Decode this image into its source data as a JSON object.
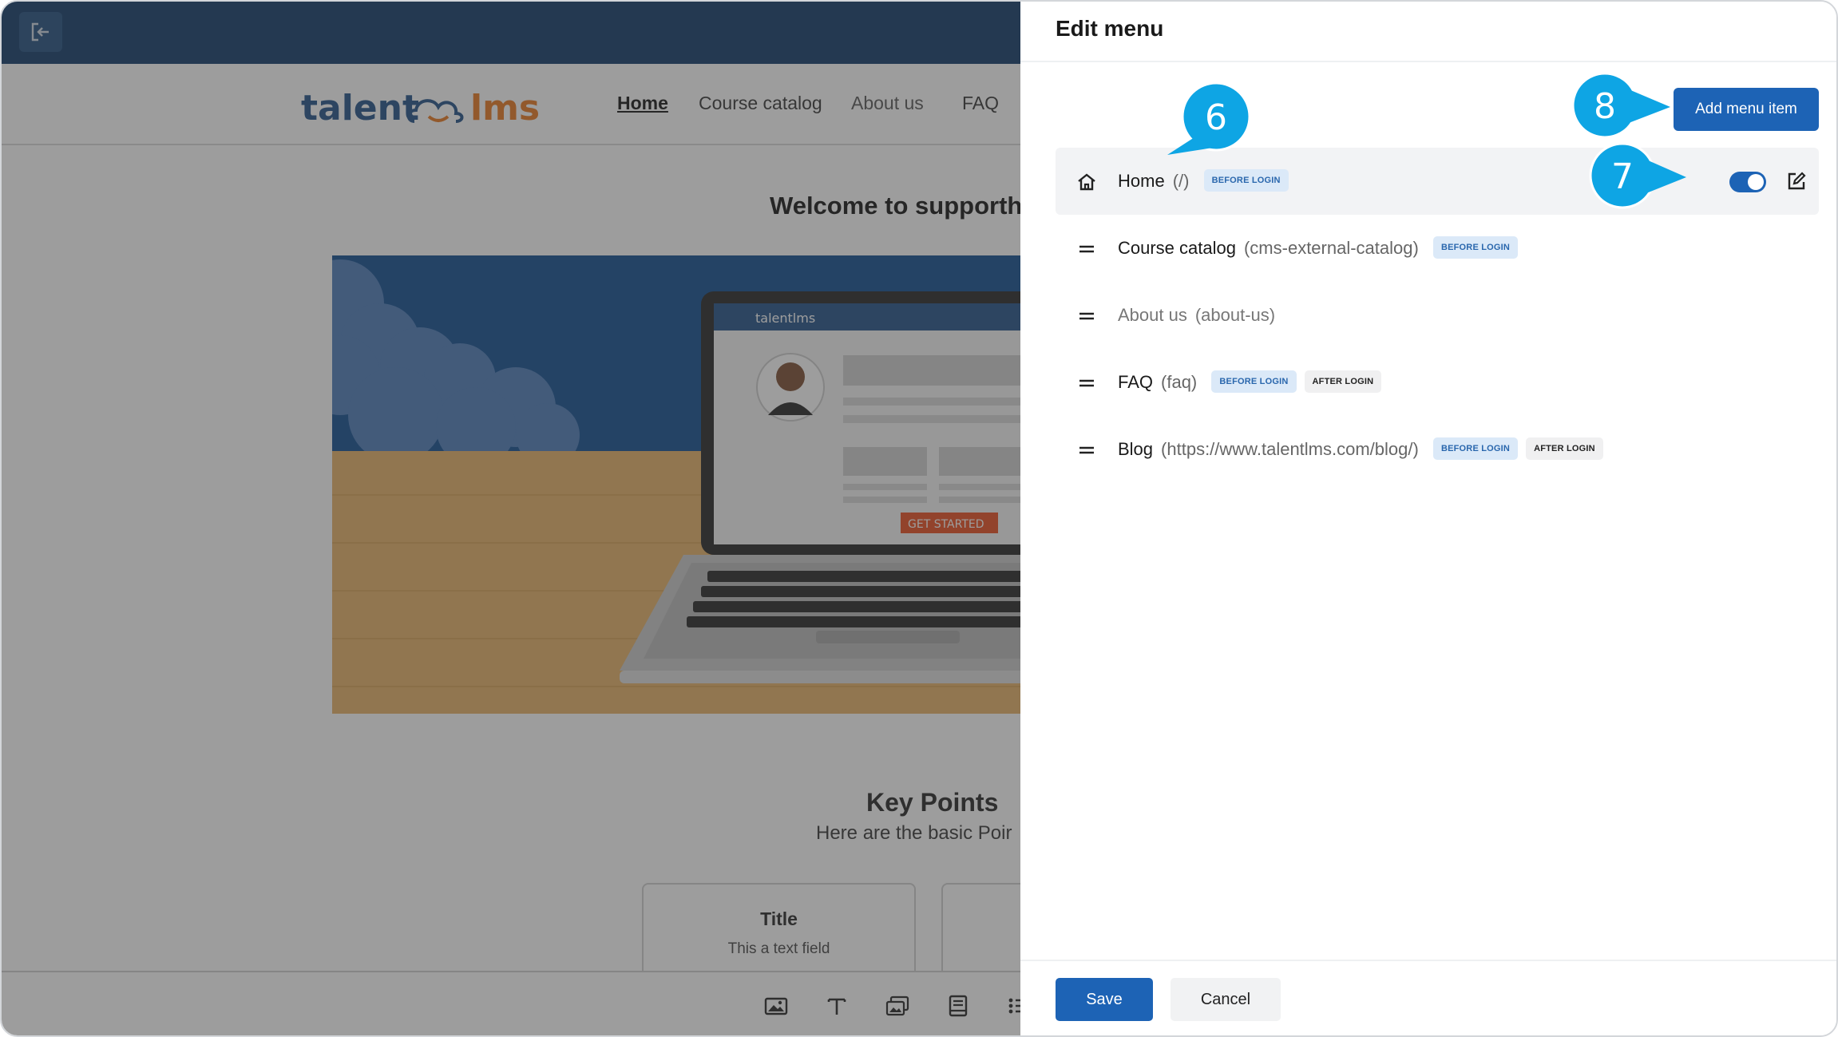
{
  "site": {
    "logo_left": "talent",
    "logo_right": "lms",
    "nav": [
      "Home",
      "Course catalog",
      "About us",
      "FAQ"
    ],
    "welcome_title": "Welcome to supporth",
    "hero": {
      "laptop_logo": "talentlms",
      "cta": "GET STARTED"
    },
    "key_points_title": "Key Points",
    "key_points_sub": "Here are the basic Poir",
    "card": {
      "title": "Title",
      "text": "This a text field"
    }
  },
  "panel": {
    "title": "Edit menu",
    "add_button": "Add menu item",
    "items": [
      {
        "label": "Home",
        "path": "(/)",
        "tags": [
          "BEFORE LOGIN"
        ],
        "icon": "home-icon"
      },
      {
        "label": "Course catalog",
        "path": "(cms-external-catalog)",
        "tags": [
          "BEFORE LOGIN"
        ],
        "icon": "drag-handle-icon"
      },
      {
        "label": "About us",
        "path": "(about-us)",
        "tags": [],
        "icon": "drag-handle-icon"
      },
      {
        "label": "FAQ",
        "path": "(faq)",
        "tags": [
          "BEFORE LOGIN",
          "AFTER LOGIN"
        ],
        "icon": "drag-handle-icon"
      },
      {
        "label": "Blog",
        "path": "(https://www.talentlms.com/blog/)",
        "tags": [
          "BEFORE LOGIN",
          "AFTER LOGIN"
        ],
        "icon": "drag-handle-icon"
      }
    ],
    "save_button": "Save",
    "cancel_button": "Cancel"
  },
  "callouts": [
    "6",
    "7",
    "8"
  ],
  "colors": {
    "topbar": "#0d3766",
    "primary": "#1d63b5",
    "callout": "#0ea5e4",
    "tag_before_bg": "#dbe9f8",
    "tag_after_bg": "#f0f0f1"
  }
}
